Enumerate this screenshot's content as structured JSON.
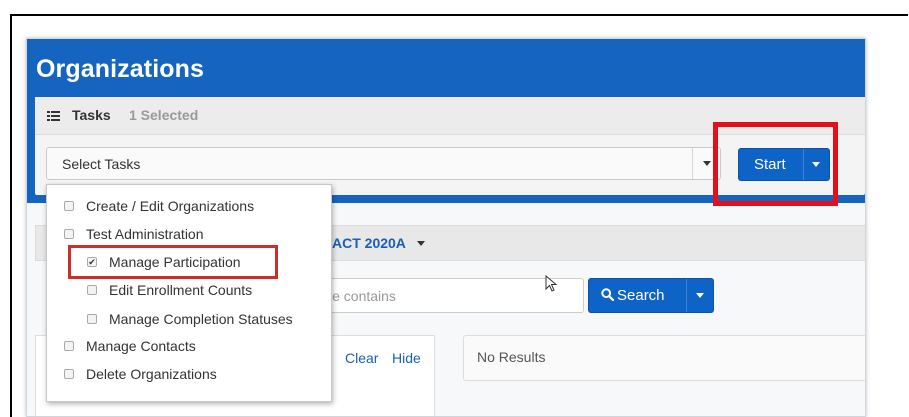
{
  "page": {
    "title": "Organizations"
  },
  "tasks": {
    "label": "Tasks",
    "selected_text": "1 Selected",
    "select_placeholder": "Select Tasks",
    "start_label": "Start"
  },
  "task_menu": {
    "items": [
      {
        "label": "Create / Edit Organizations",
        "checked": false,
        "indent": 0
      },
      {
        "label": "Test Administration",
        "checked": false,
        "indent": 0
      },
      {
        "label": "Manage Participation",
        "checked": true,
        "indent": 1
      },
      {
        "label": "Edit Enrollment Counts",
        "checked": false,
        "indent": 1
      },
      {
        "label": "Manage Completion Statuses",
        "checked": false,
        "indent": 1
      },
      {
        "label": "Manage Contacts",
        "checked": false,
        "indent": 0
      },
      {
        "label": "Delete Organizations",
        "checked": false,
        "indent": 0
      }
    ]
  },
  "admin_bar": {
    "text": "ACT 2020A"
  },
  "filter": {
    "placeholder_partial": "le contains"
  },
  "search": {
    "label": "Search"
  },
  "links": {
    "clear": "Clear",
    "hide": "Hide"
  },
  "results": {
    "text": "No Results"
  },
  "colors": {
    "header_blue": "#1565c0",
    "button_blue": "#0d63c6",
    "highlight_red": "#e3101c"
  }
}
